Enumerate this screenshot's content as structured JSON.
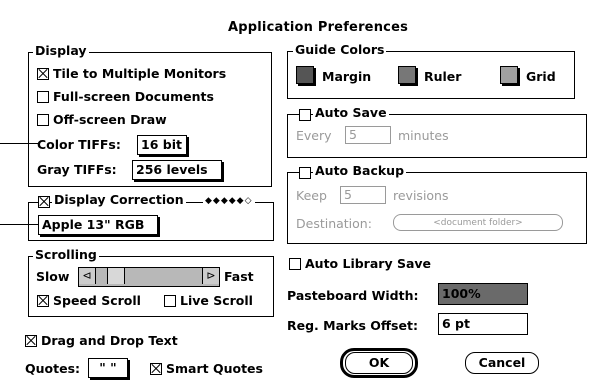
{
  "window": {
    "title": "Application Preferences"
  },
  "display": {
    "group_label": "Display",
    "tile_monitors": "Tile to Multiple Monitors",
    "fullscreen_docs": "Full-screen Documents",
    "offscreen_draw": "Off-screen Draw",
    "color_tiffs_label": "Color TIFFs:",
    "color_tiffs_value": "16 bit",
    "gray_tiffs_label": "Gray TIFFs:",
    "gray_tiffs_value": "256 levels"
  },
  "display_correction": {
    "label": "Display Correction",
    "monitor_value": "Apple 13\" RGB"
  },
  "scrolling": {
    "group_label": "Scrolling",
    "slow_label": "Slow",
    "fast_label": "Fast",
    "speed_scroll": "Speed Scroll",
    "live_scroll": "Live Scroll",
    "slider_position": 0.12
  },
  "drag_drop": "Drag and Drop Text",
  "quotes": {
    "label": "Quotes:",
    "value": "\" \"",
    "smart_quotes": "Smart Quotes"
  },
  "guide_colors": {
    "group_label": "Guide Colors",
    "items": [
      {
        "label": "Margin",
        "color": "#555555"
      },
      {
        "label": "Ruler",
        "color": "#777777"
      },
      {
        "label": "Grid",
        "color": "#a0a0a0"
      }
    ]
  },
  "auto_save": {
    "label": "Auto Save",
    "every_label": "Every",
    "every_value": "5",
    "unit": "minutes"
  },
  "auto_backup": {
    "label": "Auto Backup",
    "keep_label": "Keep",
    "keep_value": "5",
    "unit": "revisions",
    "destination_label": "Destination:",
    "destination_value": "<document folder>"
  },
  "auto_library_save": "Auto Library Save",
  "pasteboard_width": {
    "label": "Pasteboard Width:",
    "value": "100%"
  },
  "reg_marks_offset": {
    "label": "Reg. Marks Offset:",
    "value": "6 pt"
  },
  "buttons": {
    "ok": "OK",
    "cancel": "Cancel"
  }
}
